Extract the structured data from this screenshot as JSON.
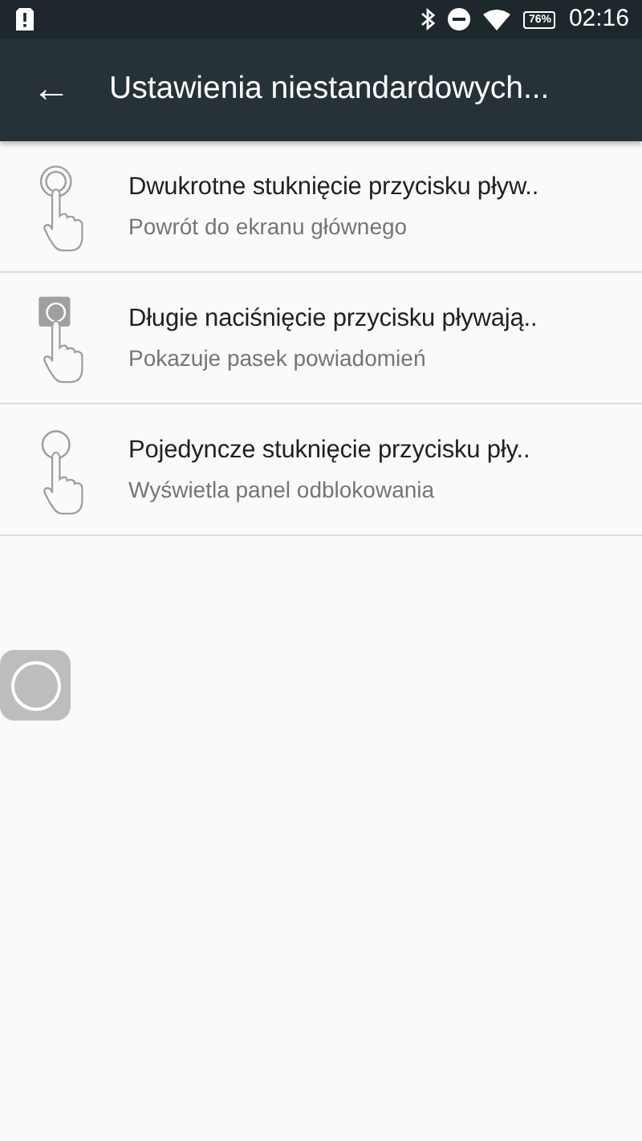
{
  "status_bar": {
    "battery": "76%",
    "time": "02:16"
  },
  "toolbar": {
    "back": "←",
    "title": "Ustawienia niestandardowych..."
  },
  "items": [
    {
      "kind": "double",
      "title": "Dwukrotne stuknięcie przycisku pływ..",
      "subtitle": "Powrót do ekranu głównego"
    },
    {
      "kind": "long",
      "title": "Długie naciśnięcie przycisku pływają..",
      "subtitle": "Pokazuje pasek powiadomień"
    },
    {
      "kind": "single",
      "title": "Pojedyncze stuknięcie przycisku pły..",
      "subtitle": "Wyświetla panel odblokowania"
    }
  ]
}
